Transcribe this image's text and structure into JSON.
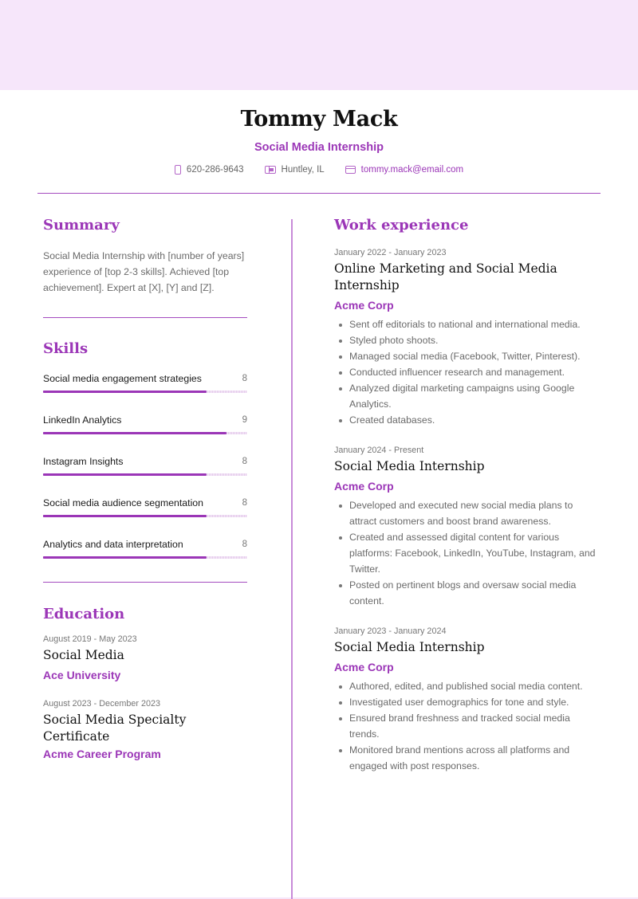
{
  "colors": {
    "accent": "#9b36b7",
    "band": "#f6e6fa",
    "text_muted": "#6a6a6a"
  },
  "header": {
    "name": "Tommy Mack",
    "role": "Social Media Internship",
    "contacts": [
      {
        "icon": "phone-icon",
        "text": "620-286-9643"
      },
      {
        "icon": "location-icon",
        "text": "Huntley, IL"
      },
      {
        "icon": "email-icon",
        "text": "tommy.mack@email.com"
      }
    ]
  },
  "summary": {
    "title": "Summary",
    "text": "Social Media Internship with [number of years] experience of [top 2-3 skills]. Achieved [top achievement]. Expert at [X], [Y] and [Z]."
  },
  "skills": {
    "title": "Skills",
    "max": 10,
    "items": [
      {
        "name": "Social media engagement strategies",
        "value": 8
      },
      {
        "name": "LinkedIn Analytics",
        "value": 9
      },
      {
        "name": "Instagram Insights",
        "value": 8
      },
      {
        "name": "Social media audience segmentation",
        "value": 8
      },
      {
        "name": "Analytics and data interpretation",
        "value": 8
      }
    ]
  },
  "education": {
    "title": "Education",
    "items": [
      {
        "date": "August 2019 - May 2023",
        "degree": "Social Media",
        "school": "Ace University"
      },
      {
        "date": "August 2023 - December 2023",
        "degree": "Social Media Specialty Certificate",
        "school": "Acme Career Program"
      }
    ]
  },
  "work": {
    "title": "Work experience",
    "items": [
      {
        "date": "January 2022 - January 2023",
        "title": "Online Marketing and Social Media Internship",
        "company": "Acme Corp",
        "bullets": [
          "Sent off editorials to national and international media.",
          "Styled photo shoots.",
          "Managed social media (Facebook, Twitter, Pinterest).",
          "Conducted influencer research and management.",
          "Analyzed digital marketing campaigns using Google Analytics.",
          "Created databases."
        ]
      },
      {
        "date": "January 2024 - Present",
        "title": "Social Media Internship",
        "company": "Acme Corp",
        "bullets": [
          "Developed and executed new social media plans to attract customers and boost brand awareness.",
          "Created and assessed digital content for various platforms: Facebook, LinkedIn, YouTube, Instagram, and Twitter.",
          "Posted on pertinent blogs and oversaw social media content."
        ]
      },
      {
        "date": "January 2023 - January 2024",
        "title": "Social Media Internship",
        "company": "Acme Corp",
        "bullets": [
          "Authored, edited, and published social media content.",
          "Investigated user demographics for tone and style.",
          "Ensured brand freshness and tracked social media trends.",
          "Monitored brand mentions across all platforms and engaged with post responses."
        ]
      }
    ]
  }
}
